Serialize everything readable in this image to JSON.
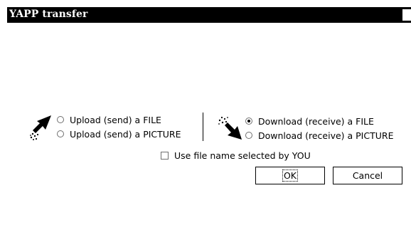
{
  "window": {
    "title": "YAPP transfer"
  },
  "upload": {
    "icon": "upload-arrow-icon",
    "options": [
      {
        "label": "Upload (send) a FILE",
        "checked": false
      },
      {
        "label": "Upload (send) a PICTURE",
        "checked": false
      }
    ]
  },
  "download": {
    "icon": "download-arrow-icon",
    "options": [
      {
        "label": "Download (receive) a FILE",
        "checked": true
      },
      {
        "label": "Download (receive) a PICTURE",
        "checked": false
      }
    ]
  },
  "use_filename": {
    "label": "Use file name selected by YOU",
    "checked": false
  },
  "buttons": {
    "ok_label": "OK",
    "cancel_label": "Cancel"
  }
}
